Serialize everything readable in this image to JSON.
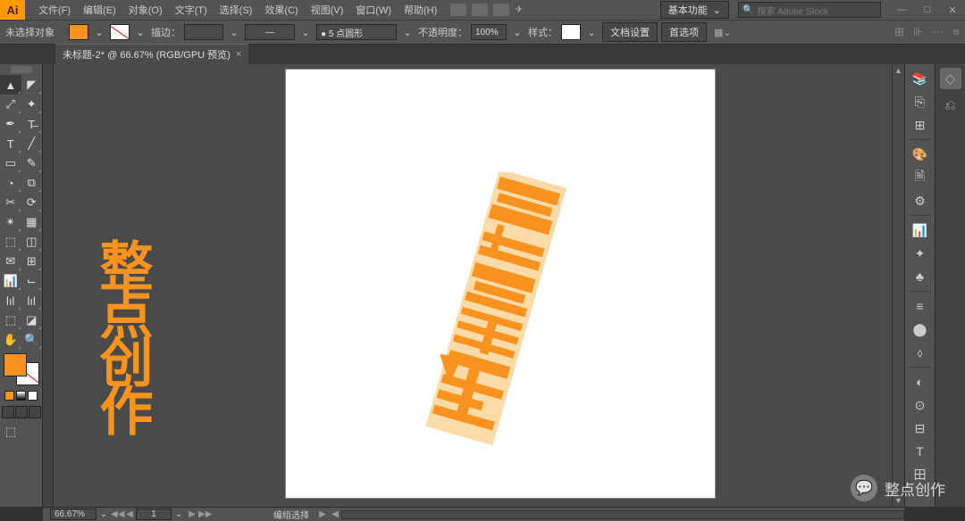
{
  "app": {
    "logo": "Ai"
  },
  "menu": [
    "文件(F)",
    "编辑(E)",
    "对象(O)",
    "文字(T)",
    "选择(S)",
    "效果(C)",
    "视图(V)",
    "窗口(W)",
    "帮助(H)"
  ],
  "workspace": {
    "label": "基本功能",
    "chev": "⌄"
  },
  "search": {
    "icon": "🔍",
    "placeholder": "搜索 Adobe Stock"
  },
  "winbtns": {
    "min": "—",
    "max": "□",
    "close": "✕"
  },
  "ctrl": {
    "noselect": "未选择对象",
    "stroke_label": "描边：",
    "stroke_val": "",
    "brush_val": "● 5 点圆形",
    "opacity_label": "不透明度：",
    "opacity_val": "100%",
    "style_label": "样式：",
    "docset": "文档设置",
    "prefs": "首选项",
    "chev": "⌄"
  },
  "doctab": {
    "title": "未标题-2* @ 66.67% (RGB/GPU 预览)",
    "close": "×"
  },
  "tools": {
    "rows": [
      [
        "▲",
        "◤"
      ],
      [
        "⤢",
        "✦"
      ],
      [
        "✒",
        "T̶"
      ],
      [
        "T",
        "╱"
      ],
      [
        "▭",
        "✎"
      ],
      [
        "◔",
        "⧉"
      ],
      [
        "✂",
        "⟳"
      ],
      [
        "✴",
        "▦"
      ],
      [
        "⬚",
        "◫"
      ],
      [
        "✉",
        "⊞"
      ],
      [
        "📊",
        "⌙"
      ],
      [
        "lıl",
        "lıl"
      ],
      [
        "⬚",
        "◪"
      ],
      [
        "✋",
        "🔍"
      ]
    ],
    "mini": {
      "a": "#f7931e",
      "b": "#ffffff",
      "c": "none"
    }
  },
  "right1": [
    "📚",
    "⎘",
    "⊞",
    "",
    "🎨",
    "🗎",
    "⚙",
    "",
    "📊",
    "✦",
    "♣",
    "",
    "≡",
    "⬤",
    "⬨",
    "",
    "◐",
    "⊙",
    "⊟",
    "T",
    "田"
  ],
  "right2": [
    "◇",
    "⎌"
  ],
  "status": {
    "zoom": "66.67%",
    "arr_l": "◀◀",
    "arr_l2": "◀",
    "artnum": "1",
    "arr_r": "▶",
    "arr_r2": "▶▶",
    "mode": "编组选择",
    "tri_l": "▶",
    "tri_r": "◀"
  },
  "watermark": {
    "icon": "💬",
    "text": "整点创作"
  },
  "overlay_text": "整点创作"
}
